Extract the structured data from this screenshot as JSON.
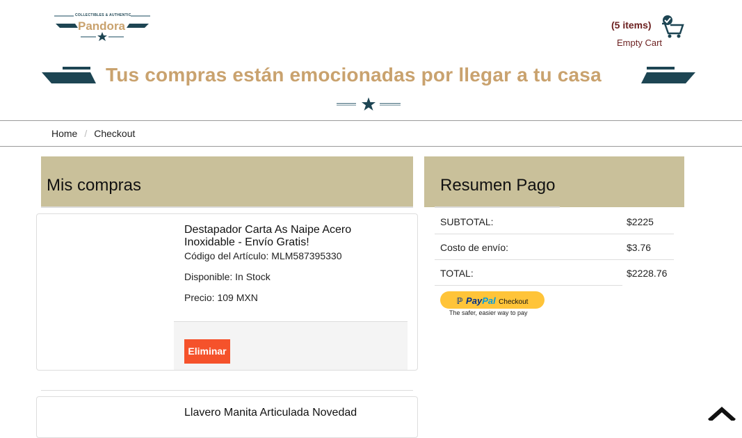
{
  "header": {
    "logo_small_text": "COLLECTIBLES & AUTHENTIC",
    "logo_brand": "Pandora",
    "cart_count": "(5 items)",
    "cart_empty": "Empty Cart",
    "banner_text": "Tus compras están emocionadas por llegar a tu casa"
  },
  "breadcrumb": {
    "home": "Home",
    "separator": "/",
    "current": "Checkout"
  },
  "cart_panel": {
    "title": "Mis compras",
    "items": [
      {
        "title": "Destapador Carta As Naipe Acero Inoxidable - Envío Gratis!",
        "code": "Código del Artículo: MLM587395330",
        "availability": "Disponible: In Stock",
        "price": "Precio: 109 MXN",
        "remove_label": "Eliminar"
      },
      {
        "title": "Llavero Manita Articulada Novedad"
      }
    ]
  },
  "summary_panel": {
    "title": "Resumen Pago",
    "rows": [
      {
        "label": "SUBTOTAL:",
        "value": "$2225"
      },
      {
        "label": "Costo de envío:",
        "value": "$3.76"
      },
      {
        "label": "TOTAL:",
        "value": "$2228.76"
      }
    ],
    "paypal_brand_1": "Pay",
    "paypal_brand_2": "Pal",
    "paypal_checkout": "Checkout",
    "paypal_tagline": "The safer, easier way to pay"
  },
  "colors": {
    "panel_header": "#c9c09a",
    "accent_gold": "#c9a26e",
    "remove_button": "#f5522b",
    "paypal_yellow": "#ffc439",
    "dark_teal": "#1d4553"
  }
}
